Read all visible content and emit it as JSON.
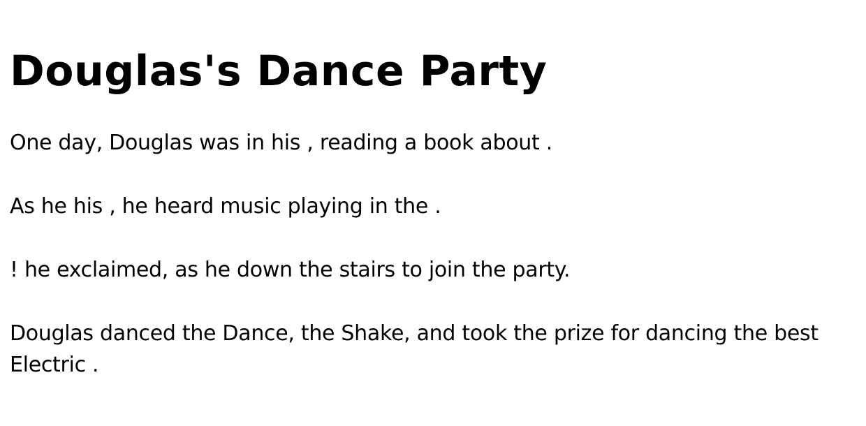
{
  "story": {
    "title": "Douglas's Dance Party",
    "paragraphs": [
      "One day, Douglas was in his , reading a book about .",
      "As he his , he heard music playing in the .",
      "! he exclaimed, as he down the stairs to join the party.",
      "Douglas danced the Dance, the Shake, and took the prize for dancing the best Electric ."
    ]
  }
}
